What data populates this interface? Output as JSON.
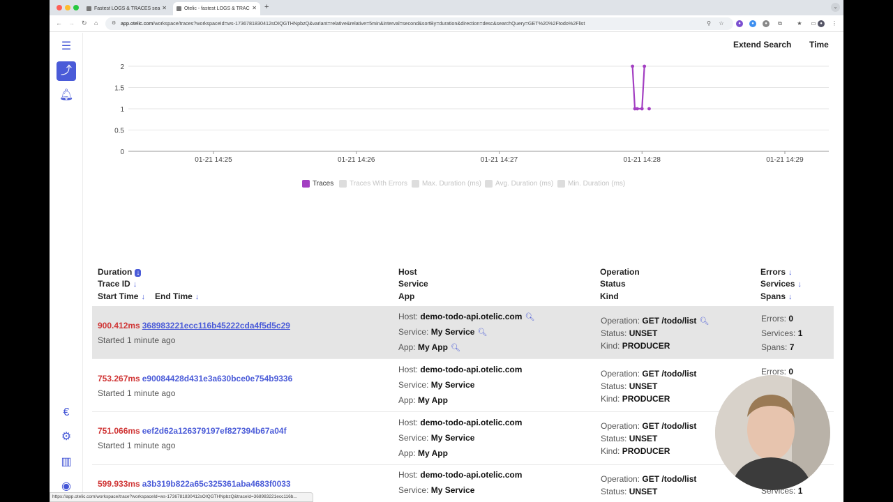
{
  "browser": {
    "tabs": [
      {
        "title": "Fastest LOGS & TRACES sea"
      },
      {
        "title": "Otelic - fastest LOGS & TRAC"
      }
    ],
    "url_host": "app.otelic.com",
    "url_path": "/workspace/traces?workspaceId=ws-1736781830412sOIQGTHNpbzQ&variant=relative&relative=5min&interval=second&sortBy=duration&direction=desc&searchQuery=GET%20%2Ftodo%2Flist",
    "status_url": "https://app.otelic.com/workspace/trace?workspaceId=ws-1736781830412sOIQGTHNpbzQ&traceId=368983221ecc116b..."
  },
  "toolbar": {
    "extend_search": "Extend Search",
    "time": "Time"
  },
  "chart_data": {
    "type": "line",
    "x": [
      "01-21 14:27:56",
      "01-21 14:27:57",
      "01-21 14:27:58",
      "01-21 14:28:00",
      "01-21 14:28:01",
      "01-21 14:28:03"
    ],
    "series": [
      {
        "name": "Traces",
        "values": [
          2,
          1,
          1,
          1,
          2,
          1
        ],
        "color": "#a33fc2"
      }
    ],
    "xticks": [
      "01-21 14:25",
      "01-21 14:26",
      "01-21 14:27",
      "01-21 14:28",
      "01-21 14:29"
    ],
    "yticks": [
      "0",
      "0.5",
      "1",
      "1.5",
      "2"
    ],
    "ylim": [
      0,
      2
    ],
    "legend": [
      "Traces",
      "Traces With Errors",
      "Max. Duration (ms)",
      "Avg. Duration (ms)",
      "Min. Duration (ms)"
    ],
    "legend_position": "bottom",
    "grid": true
  },
  "table": {
    "headers": {
      "duration": "Duration",
      "trace_id": "Trace ID",
      "start_time": "Start Time",
      "end_time": "End Time",
      "host": "Host",
      "service": "Service",
      "app": "App",
      "operation": "Operation",
      "status": "Status",
      "kind": "Kind",
      "errors": "Errors",
      "services": "Services",
      "spans": "Spans"
    },
    "labels": {
      "host": "Host:",
      "service": "Service:",
      "app": "App:",
      "operation": "Operation:",
      "status": "Status:",
      "kind": "Kind:",
      "errors": "Errors:",
      "services": "Services:",
      "spans": "Spans:"
    },
    "rows": [
      {
        "duration": "900.412ms",
        "trace_id": "368983221ecc116b45222cda4f5d5c29",
        "started": "Started 1 minute ago",
        "host": "demo-todo-api.otelic.com",
        "service": "My Service",
        "app": "My App",
        "operation": "GET /todo/list",
        "status": "UNSET",
        "kind": "PRODUCER",
        "errors": "0",
        "services": "1",
        "spans": "7"
      },
      {
        "duration": "753.267ms",
        "trace_id": "e90084428d431e3a630bce0e754b9336",
        "started": "Started 1 minute ago",
        "host": "demo-todo-api.otelic.com",
        "service": "My Service",
        "app": "My App",
        "operation": "GET /todo/list",
        "status": "UNSET",
        "kind": "PRODUCER",
        "errors": "0"
      },
      {
        "duration": "751.066ms",
        "trace_id": "eef2d62a126379197ef827394b67a04f",
        "started": "Started 1 minute ago",
        "host": "demo-todo-api.otelic.com",
        "service": "My Service",
        "app": "My App",
        "operation": "GET /todo/list",
        "status": "UNSET",
        "kind": "PRODUCER"
      },
      {
        "duration": "599.933ms",
        "trace_id": "a3b319b822a65c325361aba4683f0033",
        "host": "demo-todo-api.otelic.com",
        "service": "My Service",
        "operation": "GET /todo/list",
        "status": "UNSET",
        "services": "1"
      }
    ]
  }
}
